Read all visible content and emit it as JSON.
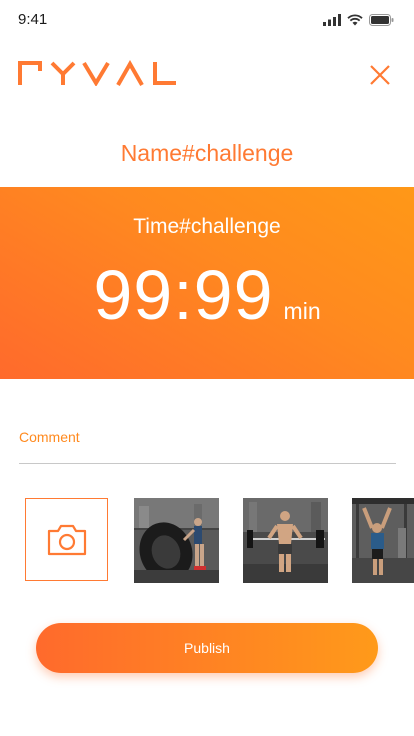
{
  "status_bar": {
    "time": "9:41"
  },
  "logo": {
    "text": "RYVAL"
  },
  "challenge": {
    "name": "Name#challenge",
    "time_title": "Time#challenge",
    "time_value": "99:99",
    "time_unit": "min"
  },
  "comment": {
    "label": "Comment"
  },
  "media": {
    "camera_icon": "camera-icon",
    "photos": [
      "tire-flip-photo",
      "barbell-lift-photo",
      "pull-up-photo"
    ]
  },
  "actions": {
    "publish_label": "Publish"
  },
  "colors": {
    "accent": "#ff7a33",
    "gradient_start": "#ff6a2c",
    "gradient_end": "#ff9817"
  }
}
